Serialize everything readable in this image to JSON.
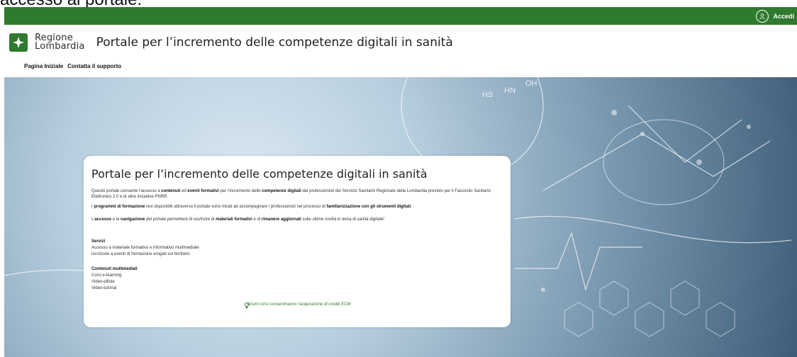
{
  "caption": "accesso al portale.",
  "topbar": {
    "login_label": "Accedi",
    "login_icon": "spid-icon"
  },
  "header": {
    "logo_line1": "Regione",
    "logo_line2": "Lombardia",
    "title": "Portale per l’incremento delle competenze digitali in sanità"
  },
  "nav": {
    "items": [
      "Pagina Iniziale",
      "Contatta il supporto"
    ]
  },
  "card": {
    "title": "Portale per l’incremento delle competenze digitali in sanità",
    "p1_parts": [
      "Questo portale consente l’accesso a ",
      "contenuti",
      " ed ",
      "eventi formativi",
      " per l’incremento delle ",
      "competenze digitali",
      " dei professionisti del Servizio Sanitario Regionale della Lombardia previsto per il Fascicolo Sanitario Elettronico 2.0 e di altre iniziative PNRR."
    ],
    "p2_parts": [
      "I ",
      "programmi di formazione",
      " resi disponibili attraverso il portale sono mirati ad accompagnare i professionisti nel processo di ",
      "familiarizzazione con gli strumenti digitali",
      "."
    ],
    "p3_parts": [
      "L’",
      "accesso",
      " e la ",
      "navigazione",
      " del portale permetterà di usufruire di ",
      "materiali formativi",
      " e di ",
      "rimanere aggiornati",
      " sulle ultime novità in tema di sanità digitale!"
    ],
    "services_title": "Servizi",
    "services": [
      "Accesso a materiale formativo e informativo multimediale",
      "Iscrizione a eventi di formazione erogati sul territorio"
    ],
    "multimedia_title": "Contenuti multimediali",
    "multimedia": [
      "Corsi e-learning",
      "Video-pillole",
      "Video-tutorial"
    ],
    "note": "Alcuni corsi consentiranno l’acquisizione di crediti ECM"
  },
  "colors": {
    "brand_green": "#2f7a2e",
    "note_green": "#2f7a2e"
  }
}
